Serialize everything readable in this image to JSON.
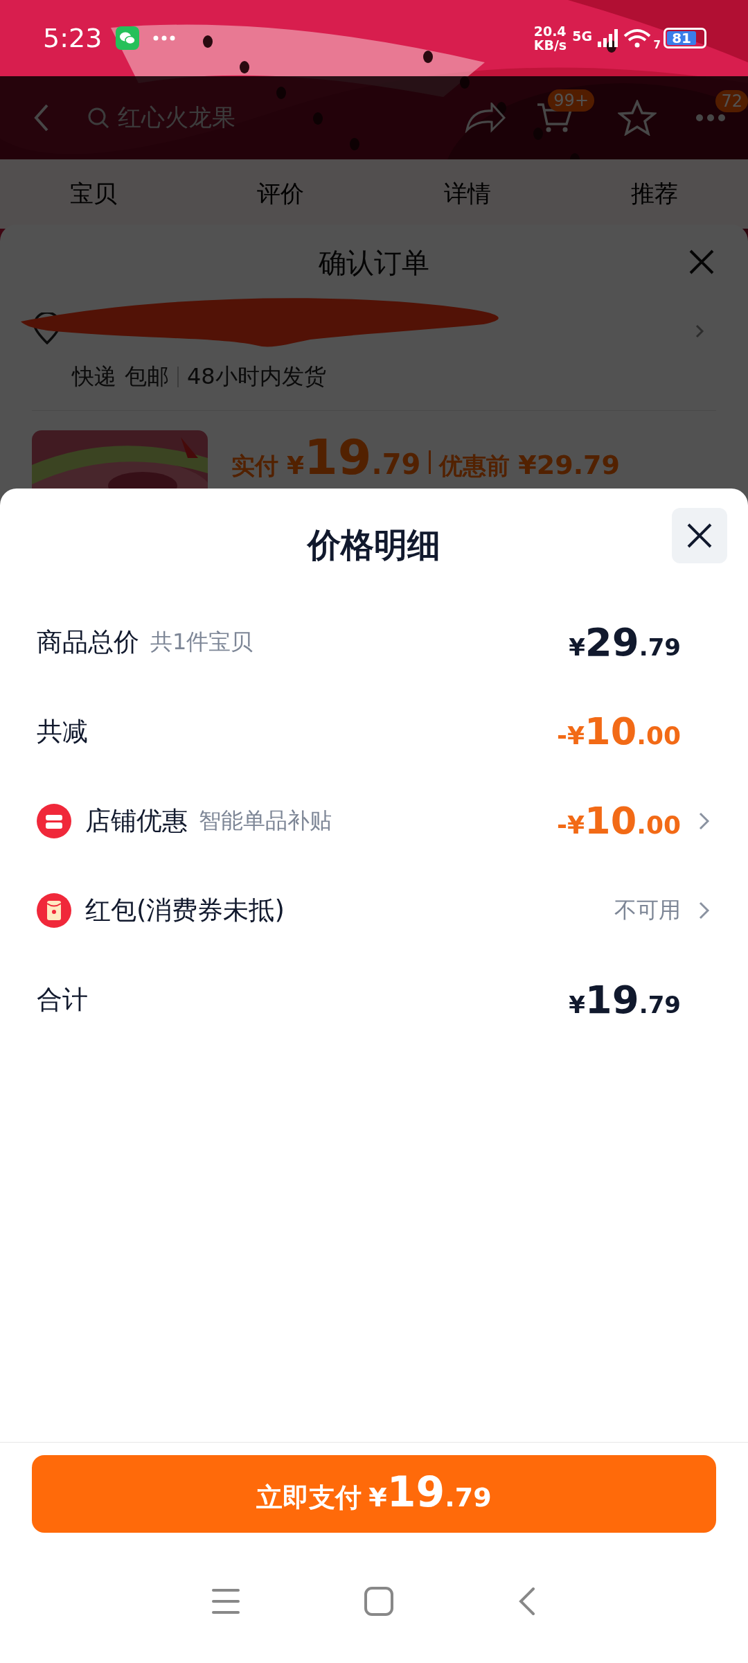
{
  "status_bar": {
    "time": "5:23",
    "speed_value": "20.4",
    "speed_unit": "KB/s",
    "network": "5G",
    "wifi_label": "7",
    "battery": "81"
  },
  "header": {
    "search_text": "红心火龙果",
    "cart_badge": "99+",
    "message_badge": "72"
  },
  "tabs": [
    {
      "label": "宝贝"
    },
    {
      "label": "评价"
    },
    {
      "label": "详情"
    },
    {
      "label": "推荐"
    }
  ],
  "confirm_order": {
    "title": "确认订单",
    "shipping": [
      "快递",
      "包邮"
    ],
    "dispatch": "48小时内发货",
    "paid_label": "实付",
    "paid_amount": "¥19.79",
    "before_label": "优惠前",
    "before_amount": "¥29.79"
  },
  "price_detail": {
    "title": "价格明细",
    "rows": [
      {
        "kind": "plain",
        "label": "商品总价",
        "note": "共1件宝贝",
        "amount": "¥29.79",
        "link": false
      },
      {
        "kind": "discount",
        "label": "共减",
        "amount": "-¥10.00",
        "link": false
      },
      {
        "kind": "shop",
        "label": "店铺优惠",
        "note": "智能单品补贴",
        "amount": "-¥10.00",
        "link": true
      },
      {
        "kind": "packet",
        "label": "红包(消费券未抵)",
        "status": "不可用",
        "link": true
      },
      {
        "kind": "plain",
        "label": "合计",
        "amount": "¥19.79",
        "link": false
      }
    ]
  },
  "pay_button": {
    "label": "立即支付",
    "amount": "¥19.79"
  }
}
